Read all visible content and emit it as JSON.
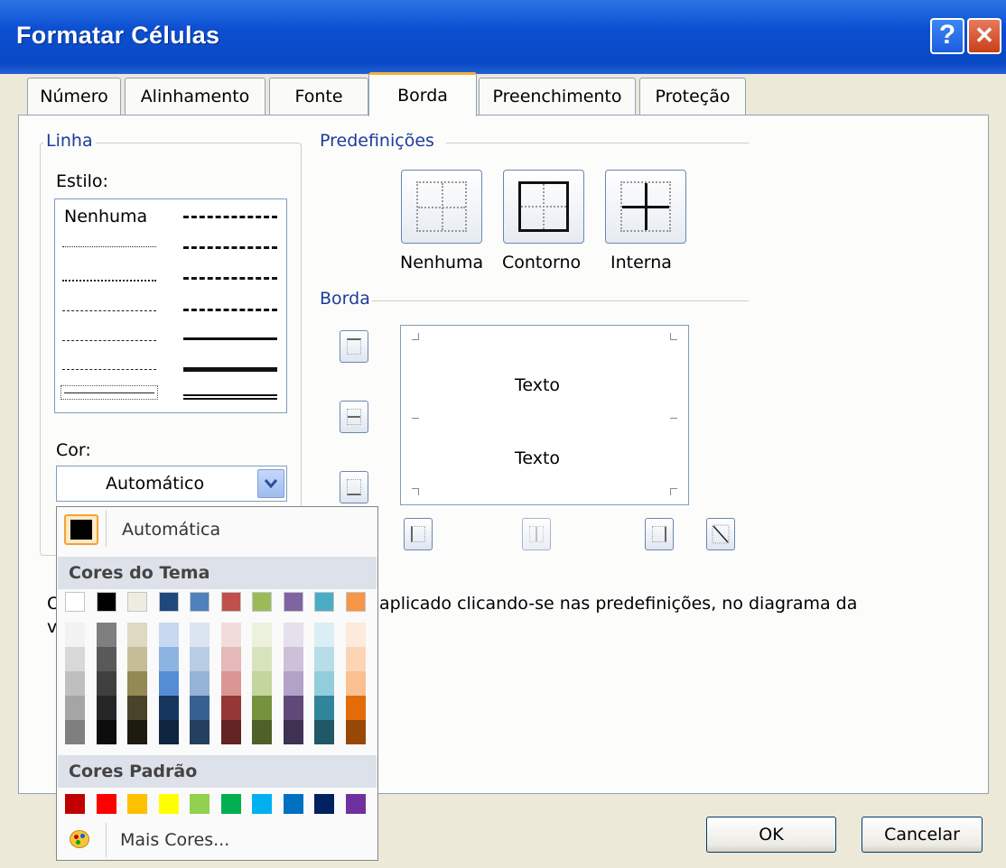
{
  "window": {
    "title": "Formatar Células",
    "help_label": "?",
    "close_label": "✕"
  },
  "tabs": [
    {
      "label": "Número"
    },
    {
      "label": "Alinhamento"
    },
    {
      "label": "Fonte"
    },
    {
      "label": "Borda",
      "active": true
    },
    {
      "label": "Preenchimento"
    },
    {
      "label": "Proteção"
    }
  ],
  "linha": {
    "group_label": "Linha",
    "estilo_label": "Estilo:",
    "none_label": "Nenhuma",
    "cor_label": "Cor:",
    "cor_value": "Automático"
  },
  "predefinicoes": {
    "group_label": "Predefinições",
    "items": [
      {
        "label": "Nenhuma"
      },
      {
        "label": "Contorno"
      },
      {
        "label": "Interna"
      }
    ]
  },
  "borda": {
    "group_label": "Borda",
    "preview_text_top": "Texto",
    "preview_text_bottom": "Texto"
  },
  "info_text_prefix": "O",
  "info_text_prefix2": "vis",
  "info_text": "aplicado clicando-se nas predefinições, no diagrama da",
  "palette": {
    "auto_label": "Automática",
    "theme_header": "Cores do Tema",
    "standard_header": "Cores Padrão",
    "more_colors": "Mais Cores...",
    "theme_top": [
      "#ffffff",
      "#000000",
      "#eeece1",
      "#1f497d",
      "#4f81bd",
      "#c0504d",
      "#9bbb59",
      "#8064a2",
      "#4bacc6",
      "#f79646"
    ],
    "theme_shades": [
      [
        "#f2f2f2",
        "#7f7f7f",
        "#ddd9c3",
        "#c6d9f0",
        "#dbe5f1",
        "#f2dcdb",
        "#ebf1dd",
        "#e5e0ec",
        "#dbeef3",
        "#fdeada"
      ],
      [
        "#d8d8d8",
        "#595959",
        "#c4bd97",
        "#8db3e2",
        "#b8cce4",
        "#e5b9b7",
        "#d7e3bc",
        "#ccc1d9",
        "#b7dde8",
        "#fbd5b5"
      ],
      [
        "#bfbfbf",
        "#3f3f3f",
        "#938953",
        "#548dd4",
        "#95b3d7",
        "#d99694",
        "#c3d69b",
        "#b2a2c7",
        "#92cddc",
        "#fac08f"
      ],
      [
        "#a5a5a5",
        "#262626",
        "#494429",
        "#17365d",
        "#366092",
        "#953734",
        "#76923c",
        "#5f497a",
        "#31859b",
        "#e36c09"
      ],
      [
        "#7f7f7f",
        "#0c0c0c",
        "#1d1b10",
        "#0f243e",
        "#244061",
        "#632423",
        "#4f6128",
        "#3f3151",
        "#205867",
        "#974806"
      ]
    ],
    "standard": [
      "#c00000",
      "#ff0000",
      "#ffc000",
      "#ffff00",
      "#92d050",
      "#00b050",
      "#00b0f0",
      "#0070c0",
      "#002060",
      "#7030a0"
    ]
  },
  "footer": {
    "ok_label": "OK",
    "cancel_label": "Cancelar"
  }
}
